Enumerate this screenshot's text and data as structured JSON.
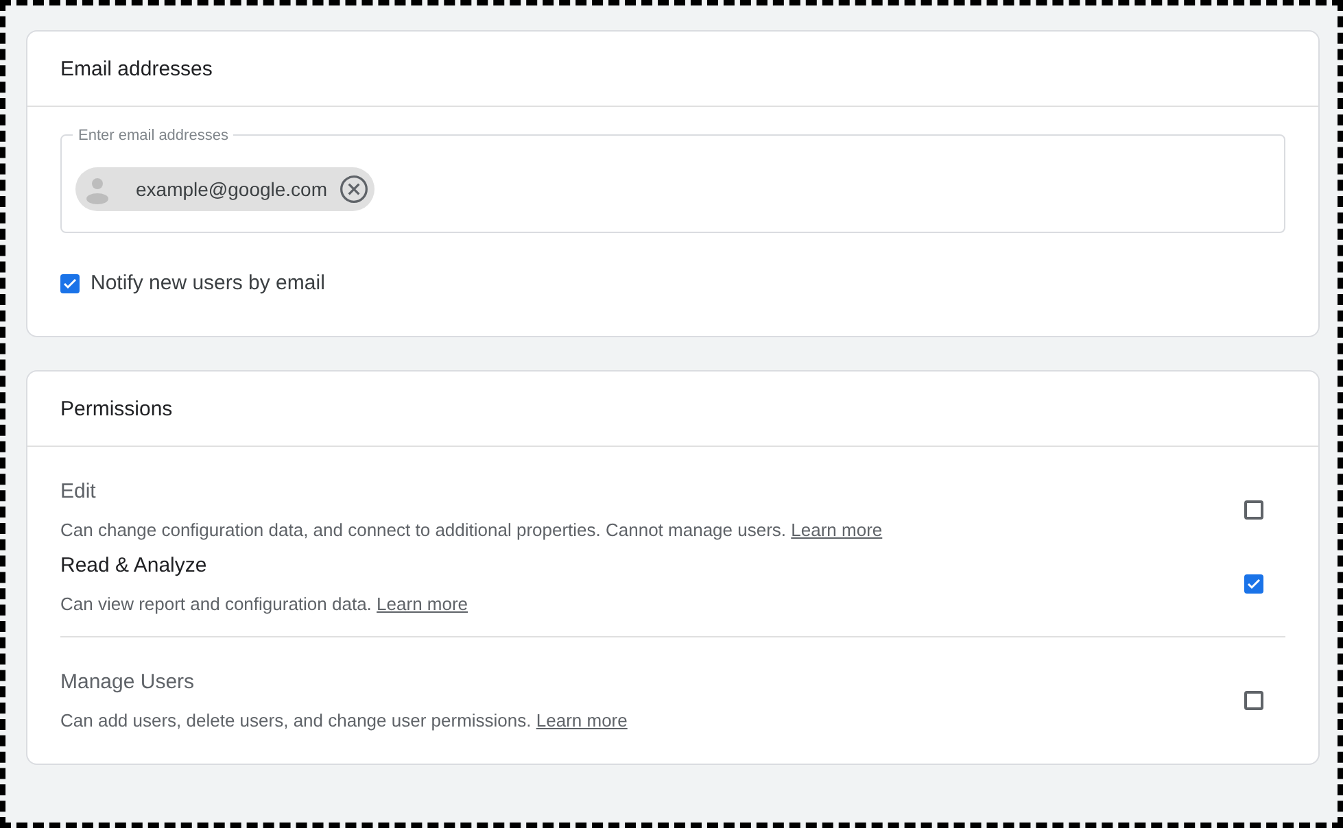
{
  "email_card": {
    "title": "Email addresses",
    "field": {
      "label": "Enter email addresses",
      "chips": [
        {
          "text": "example@google.com"
        }
      ]
    },
    "notify": {
      "label": "Notify new users by email",
      "checked": true
    }
  },
  "permissions_card": {
    "title": "Permissions",
    "groups": [
      {
        "items": [
          {
            "title": "Edit",
            "description": "Can change configuration data, and connect to additional properties. Cannot manage users.",
            "link": "Learn more",
            "checked": false
          },
          {
            "title": "Read & Analyze",
            "description": "Can view report and configuration data.",
            "link": "Learn more",
            "checked": true
          }
        ]
      },
      {
        "items": [
          {
            "title": "Manage Users",
            "description": "Can add users, delete users, and change user permissions.",
            "link": "Learn more",
            "checked": false
          }
        ]
      }
    ]
  }
}
